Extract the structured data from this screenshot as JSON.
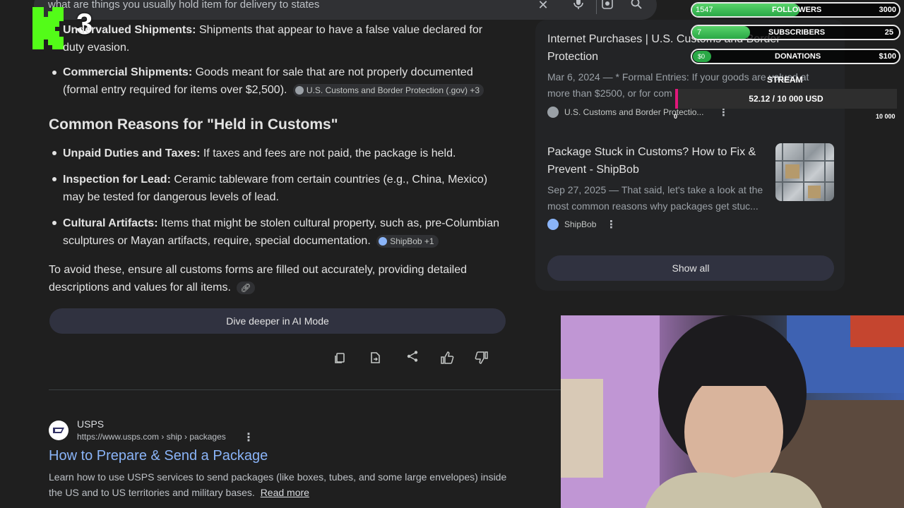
{
  "search": {
    "query": "what are things you usually hold item for delivery to states"
  },
  "logo": {
    "text": "3"
  },
  "answer": {
    "item_undervalued": {
      "label": "Undervalued Shipments:",
      "text": "Shipments that appear to have a false value declared for",
      "text2": "duty evasion."
    },
    "item_commercial": {
      "label": "Commercial Shipments:",
      "text": "Goods meant for sale that are not properly documented",
      "text2": "(formal entry required for items over $2,500).",
      "chip": "U.S. Customs and Border Protection (.gov) +3"
    },
    "section_title": "Common Reasons for \"Held in Customs\"",
    "item_unpaid": {
      "label": "Unpaid Duties and Taxes:",
      "text": "If taxes and fees are not paid, the package is held."
    },
    "item_lead": {
      "label": "Inspection for Lead:",
      "text": "Ceramic tableware from certain countries (e.g., China, Mexico)",
      "text2": "may be tested for dangerous levels of lead."
    },
    "item_cultural": {
      "label": "Cultural Artifacts:",
      "text": "Items that might be stolen cultural property, such as, pre-Columbian",
      "text2": "sculptures or Mayan artifacts, require, special documentation.",
      "chip": "ShipBob +1"
    },
    "closing": "To avoid these, ensure all customs forms are filled out accurately, providing detailed",
    "closing2": "descriptions and values for all items.",
    "dive_button": "Dive deeper in AI Mode"
  },
  "result": {
    "site": "USPS",
    "url": "https://www.usps.com › ship › packages",
    "title": "How to Prepare & Send a Package",
    "snippet": "Learn how to use USPS services to send packages (like boxes, tubes, and some large envelopes) inside",
    "snippet2": "the US and to US territories and military bases.",
    "read_more": "Read more"
  },
  "sources": {
    "card1": {
      "title": "Internet Purchases | U.S. Customs and Border",
      "title2": "Protection",
      "snippet": "Mar 6, 2024 — * Formal Entries: If your goods are valued at",
      "snippet2": "more than $2500, or for com",
      "source": "U.S. Customs and Border Protectio..."
    },
    "card2": {
      "title": "Package Stuck in Customs? How to Fix &",
      "title2": "Prevent - ShipBob",
      "snippet": "Sep 27, 2025 — That said, let's take a look at the",
      "snippet2": "most common reasons why packages get stuc...",
      "source": "ShipBob"
    },
    "show_all": "Show all"
  },
  "overlay": {
    "followers": {
      "count": "1547",
      "label": "FOLLOWERS",
      "goal": "3000",
      "progress": 0.52
    },
    "subscribers": {
      "count": "7",
      "label": "SUBSCRIBERS",
      "goal": "25",
      "progress": 0.28
    },
    "donations": {
      "count": "$0",
      "label": "DONATIONS",
      "goal": "$100",
      "progress": 0.0
    },
    "stream": {
      "label": "STREAM",
      "value": "52.12 / 10 000 USD",
      "min": "0",
      "max": "10 000",
      "progress": 0.005
    }
  },
  "colors": {
    "bg": "#1f1f1f",
    "link": "#8ab4f8",
    "overlay_green": "#2aa846",
    "logo_green": "#53fc18"
  }
}
